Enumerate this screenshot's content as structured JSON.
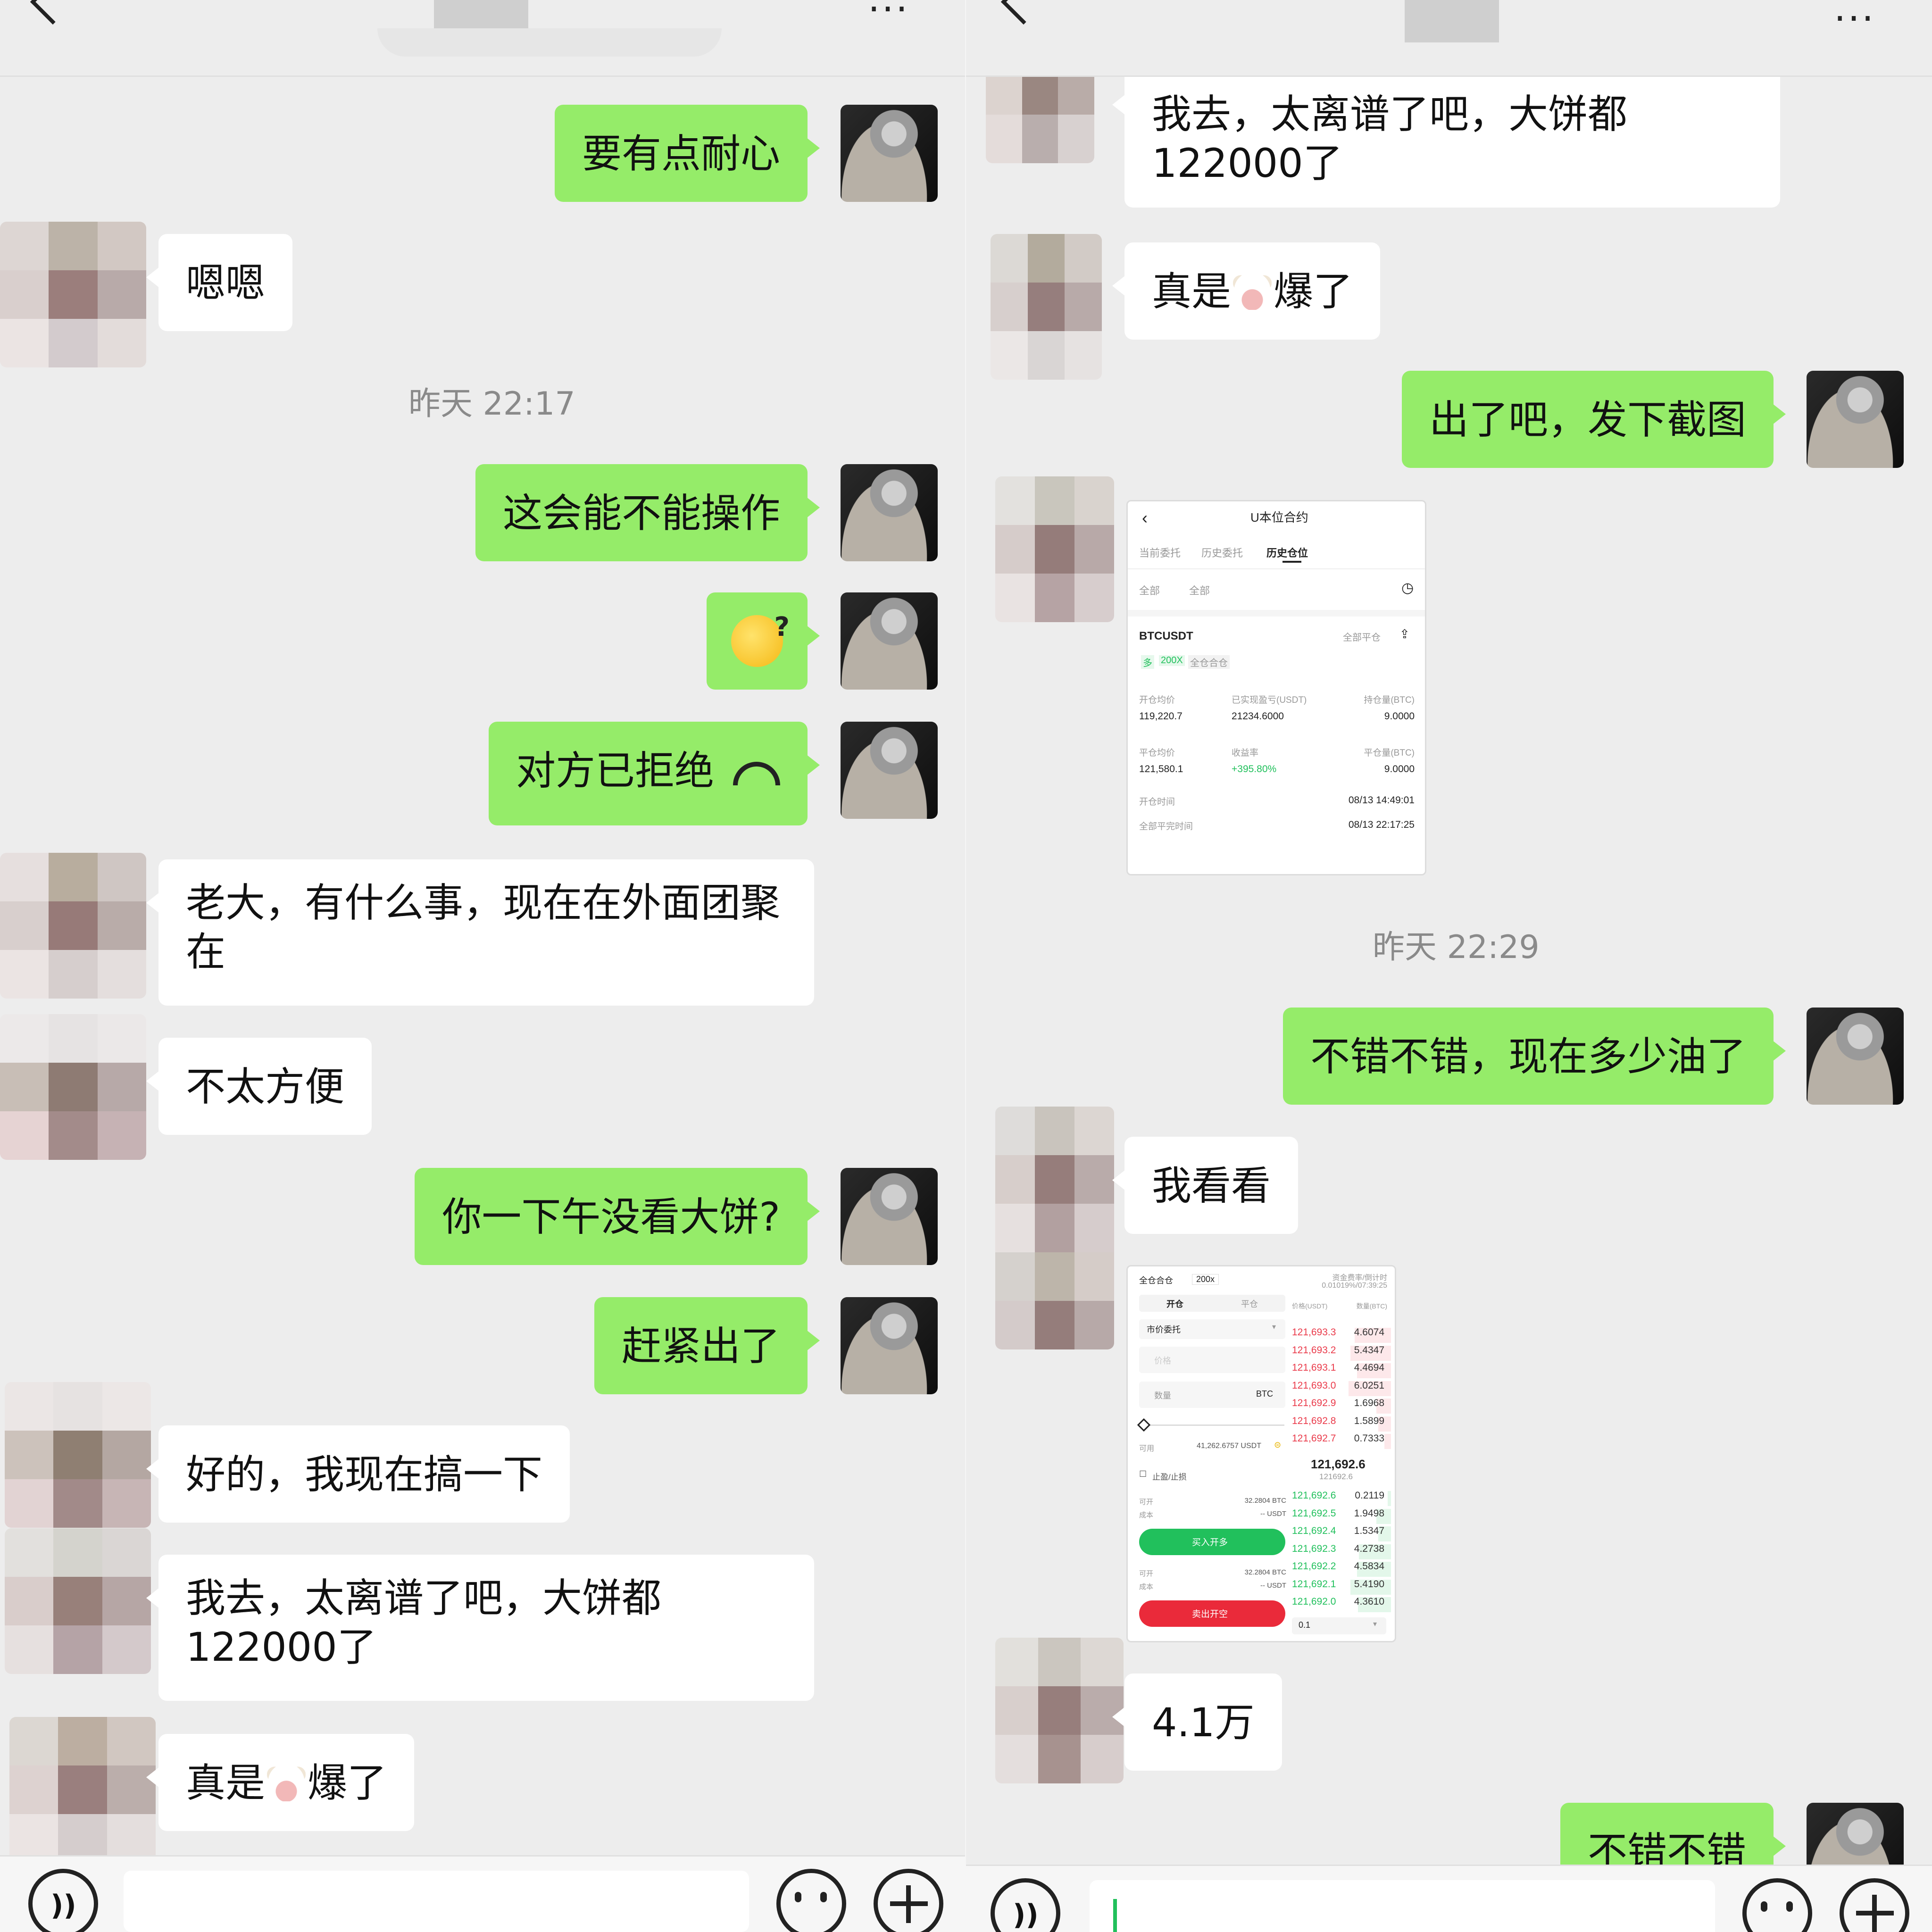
{
  "left": {
    "messages": [
      {
        "from": "me",
        "text": "要有点耐心"
      },
      {
        "from": "other",
        "text": "嗯嗯"
      },
      {
        "type": "time",
        "text": "昨天 22:17"
      },
      {
        "from": "me",
        "text": "这会能不能操作"
      },
      {
        "from": "me",
        "type": "emoji",
        "emoji": "thinking-question-emoji"
      },
      {
        "from": "me",
        "type": "call",
        "text": "对方已拒绝",
        "icon": "hangup-icon"
      },
      {
        "from": "other",
        "text": "老大，有什么事，现在在外面团聚在"
      },
      {
        "from": "other",
        "text": "不太方便"
      },
      {
        "from": "me",
        "text": "你一下午没看大饼?"
      },
      {
        "from": "me",
        "text": "赶紧出了"
      },
      {
        "from": "other",
        "text": "好的，我现在搞一下"
      },
      {
        "from": "other",
        "text": "我去，太离谱了吧，大饼都122000了"
      },
      {
        "from": "other",
        "text_before": "真是",
        "emoji": "cow-emoji",
        "text_after": "爆了"
      }
    ]
  },
  "right": {
    "messages": [
      {
        "from": "other",
        "text": "我去，太离谱了吧，大饼都122000了"
      },
      {
        "from": "other",
        "text_before": "真是",
        "emoji": "cow-emoji",
        "text_after": "爆了"
      },
      {
        "from": "me",
        "text": "出了吧，发下截图"
      },
      {
        "from": "other",
        "type": "image",
        "image": "position-history-screenshot"
      },
      {
        "type": "time",
        "text": "昨天 22:29"
      },
      {
        "from": "me",
        "text": "不错不错，现在多少油了"
      },
      {
        "from": "other",
        "text": "我看看"
      },
      {
        "from": "other",
        "type": "image",
        "image": "trading-screenshot"
      },
      {
        "from": "other",
        "text": "4.1万"
      },
      {
        "from": "me",
        "text": "不错不错"
      }
    ]
  },
  "position_shot": {
    "title": "U本位合约",
    "tabs": [
      "当前委托",
      "历史委托",
      "历史仓位"
    ],
    "filters": [
      "全部",
      "全部"
    ],
    "symbol": "BTCUSDT",
    "close_all": "全部平仓",
    "side": "多",
    "leverage": "200X",
    "margin_mode": "全仓合仓",
    "labels": {
      "open_avg": "开仓均价",
      "realized_pnl": "已实现盈亏(USDT)",
      "hold_qty": "持仓量(BTC)",
      "close_avg": "平仓均价",
      "return_rate": "收益率",
      "close_qty": "平仓量(BTC)",
      "open_time": "开仓时间",
      "close_time": "全部平完时间"
    },
    "values": {
      "open_avg": "119,220.7",
      "realized_pnl": "21234.6000",
      "hold_qty": "9.0000",
      "close_avg": "121,580.1",
      "return_rate": "+395.80%",
      "close_qty": "9.0000",
      "open_time": "08/13 14:49:01",
      "close_time": "08/13 22:17:25"
    }
  },
  "trade_shot": {
    "margin_mode": "全仓合仓",
    "leverage": "200x",
    "funding_label": "资金费率/倒计时",
    "funding_value": "0.01019%/07:39:25",
    "tabs": [
      "开仓",
      "平仓"
    ],
    "order_type": "市价委托",
    "price_placeholder": "价格",
    "qty_placeholder": "数量",
    "qty_unit": "BTC",
    "available_label": "可用",
    "available_value": "41,262.6757 USDT",
    "tp_sl": "止盈/止损",
    "open_label": "可开",
    "cost_label": "成本",
    "open_value": "32.2804 BTC",
    "cost_value": "-- USDT",
    "buy_button": "买入开多",
    "sell_button": "卖出开空",
    "ob_headers": [
      "价格(USDT)",
      "数量(BTC)"
    ],
    "asks": [
      {
        "price": "121,693.3",
        "qty": "4.6074",
        "depth": 0.85
      },
      {
        "price": "121,693.2",
        "qty": "5.4347",
        "depth": 0.95
      },
      {
        "price": "121,693.1",
        "qty": "4.4694",
        "depth": 0.8
      },
      {
        "price": "121,693.0",
        "qty": "6.0251",
        "depth": 1.0
      },
      {
        "price": "121,692.9",
        "qty": "1.6968",
        "depth": 0.35
      },
      {
        "price": "121,692.8",
        "qty": "1.5899",
        "depth": 0.3
      },
      {
        "price": "121,692.7",
        "qty": "0.7333",
        "depth": 0.15
      }
    ],
    "last_price": "121,692.6",
    "mark_price": "121692.6",
    "bids": [
      {
        "price": "121,692.6",
        "qty": "0.2119",
        "depth": 0.08
      },
      {
        "price": "121,692.5",
        "qty": "1.9498",
        "depth": 0.35
      },
      {
        "price": "121,692.4",
        "qty": "1.5347",
        "depth": 0.3
      },
      {
        "price": "121,692.3",
        "qty": "4.2738",
        "depth": 0.75
      },
      {
        "price": "121,692.2",
        "qty": "4.5834",
        "depth": 0.8
      },
      {
        "price": "121,692.1",
        "qty": "5.4190",
        "depth": 0.95
      },
      {
        "price": "121,692.0",
        "qty": "4.3610",
        "depth": 0.78
      }
    ],
    "depth_select": "0.1"
  },
  "colors": {
    "me_bubble": "#95ec69",
    "other_bubble": "#ffffff",
    "background": "#ededed",
    "ask": "#ea3a4a",
    "bid": "#21c05c"
  }
}
